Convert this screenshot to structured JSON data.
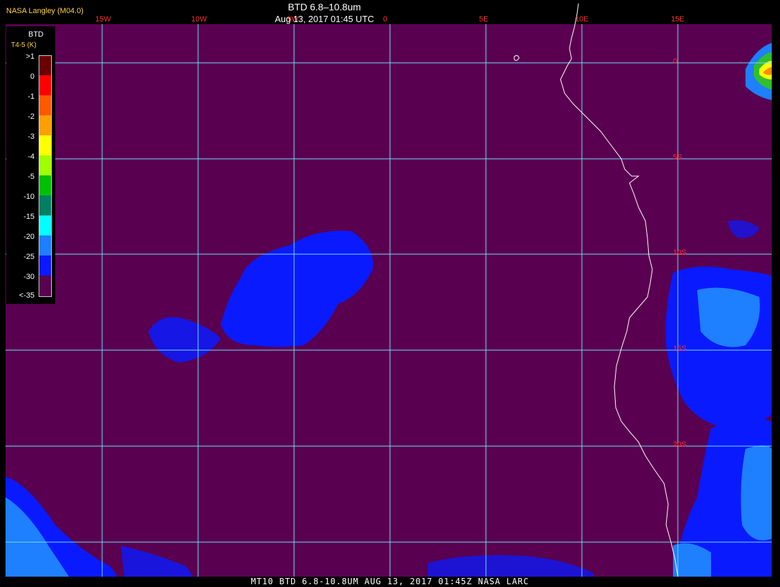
{
  "header": {
    "credit": "NASA Langley (M04.0)",
    "title": "BTD 6.8–10.8um",
    "datetime": "Aug 13, 2017 01:45 UTC"
  },
  "footer": {
    "caption": "MT10  BTD 6.8-10.8UM   AUG 13, 2017 01:45Z   NASA LARC"
  },
  "grid": {
    "color": "#6ee0ff",
    "label_color": "#ff3030",
    "longitudes": [
      "15W",
      "10W",
      "5W",
      "0",
      "5E",
      "10E",
      "15E"
    ],
    "latitudes": [
      "0",
      "5S",
      "10S",
      "15S",
      "20S"
    ]
  },
  "legend": {
    "title": "BTD",
    "units": "T4-5 (K)",
    "entries": [
      {
        "label": ">1",
        "color": "#6b0000"
      },
      {
        "label": "0",
        "color": "#ff0000"
      },
      {
        "label": "-1",
        "color": "#ff5a00"
      },
      {
        "label": "-2",
        "color": "#ffa000"
      },
      {
        "label": "-3",
        "color": "#ffff00"
      },
      {
        "label": "-4",
        "color": "#a0ff00"
      },
      {
        "label": "-5",
        "color": "#00c000"
      },
      {
        "label": "-10",
        "color": "#008060"
      },
      {
        "label": "-15",
        "color": "#00ffff"
      },
      {
        "label": "-20",
        "color": "#1e7fff"
      },
      {
        "label": "-25",
        "color": "#0a1aff"
      },
      {
        "label": "-30",
        "color": "#5a0050"
      },
      {
        "label": "<-35",
        "color": "#5a0050"
      }
    ]
  }
}
